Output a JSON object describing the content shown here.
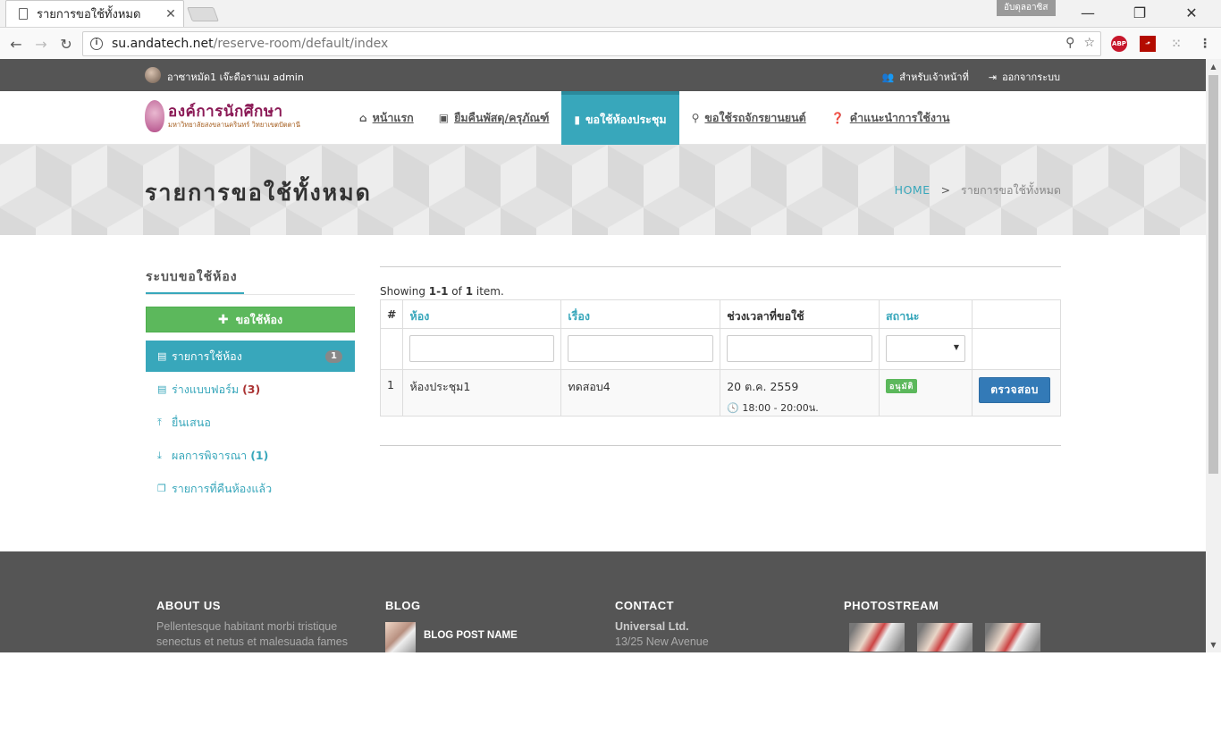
{
  "browser": {
    "tab_title": "รายการขอใช้ทั้งหมด",
    "tab_close": "✕",
    "user_badge": "อับดุลอาซิส",
    "url_host": "su.andatech.net",
    "url_path": "/reserve-room/default/index",
    "window": {
      "minimize": "—",
      "restore": "❐",
      "close": "✕"
    },
    "extensions": [
      "ABP",
      "PDF",
      "ext"
    ]
  },
  "topbar": {
    "greeting": "อาซาหมัด1 เจ๊ะดือราแม admin",
    "staff_link": "สำหรับเจ้าหน้าที่",
    "logout_link": "ออกจากระบบ"
  },
  "logo": {
    "name": "องค์การนักศึกษา",
    "subtitle": "มหาวิทยาลัยสงขลานครินทร์ วิทยาเขตปัตตานี"
  },
  "menu": [
    {
      "label": "หน้าแรก",
      "icon": "home-icon",
      "active": false
    },
    {
      "label": "ยืมคืนพัสดุ/ครุภัณฑ์",
      "icon": "box-icon",
      "active": false
    },
    {
      "label": "ขอใช้ห้องประชุม",
      "icon": "building-icon",
      "active": true
    },
    {
      "label": "ขอใช้รถจักรยานยนต์",
      "icon": "motorcycle-icon",
      "active": false
    },
    {
      "label": "คำแนะนำการใช้งาน",
      "icon": "question-icon",
      "active": false
    }
  ],
  "heading": {
    "title": "รายการขอใช้ทั้งหมด",
    "breadcrumb_home": "HOME",
    "breadcrumb_sep": ">",
    "breadcrumb_current": "รายการขอใช้ทั้งหมด"
  },
  "sidebar": {
    "title": "ระบบขอใช้ห้อง",
    "add_button": "ขอใช้ห้อง",
    "items": [
      {
        "label": "รายการใช้ห้อง",
        "badge": "1"
      },
      {
        "label": "ร่างแบบฟอร์ม",
        "count": "(3)"
      },
      {
        "label": "ยื่นเสนอ"
      },
      {
        "label": "ผลการพิจารณา",
        "count": "(1)"
      },
      {
        "label": "รายการที่คืนห้องแล้ว"
      }
    ]
  },
  "grid": {
    "summary_prefix": "Showing",
    "summary_range": "1-1",
    "summary_of": "of",
    "summary_total": "1",
    "summary_suffix": "item.",
    "columns": [
      "#",
      "ห้อง",
      "เรื่อง",
      "ช่วงเวลาที่ขอใช้",
      "สถานะ",
      ""
    ],
    "rows": [
      {
        "index": "1",
        "room": "ห้องประชุม1",
        "subject": "ทดสอบ4",
        "date": "20 ต.ค. 2559",
        "time": "18:00 - 20:00น.",
        "status": "อนุมัติ",
        "action": "ตรวจสอบ"
      }
    ]
  },
  "footer": {
    "about_title": "ABOUT US",
    "about_text": "Pellentesque habitant morbi tristique senectus et netus et malesuada fames",
    "blog_title": "BLOG",
    "blog_post": "BLOG POST NAME",
    "contact_title": "CONTACT",
    "contact_company": "Universal Ltd.",
    "contact_address": "13/25 New Avenue",
    "photostream_title": "PHOTOSTREAM"
  },
  "colors": {
    "accent": "#38a7bb",
    "success": "#5cb85c",
    "primary": "#337ab7",
    "dark": "#555555"
  }
}
